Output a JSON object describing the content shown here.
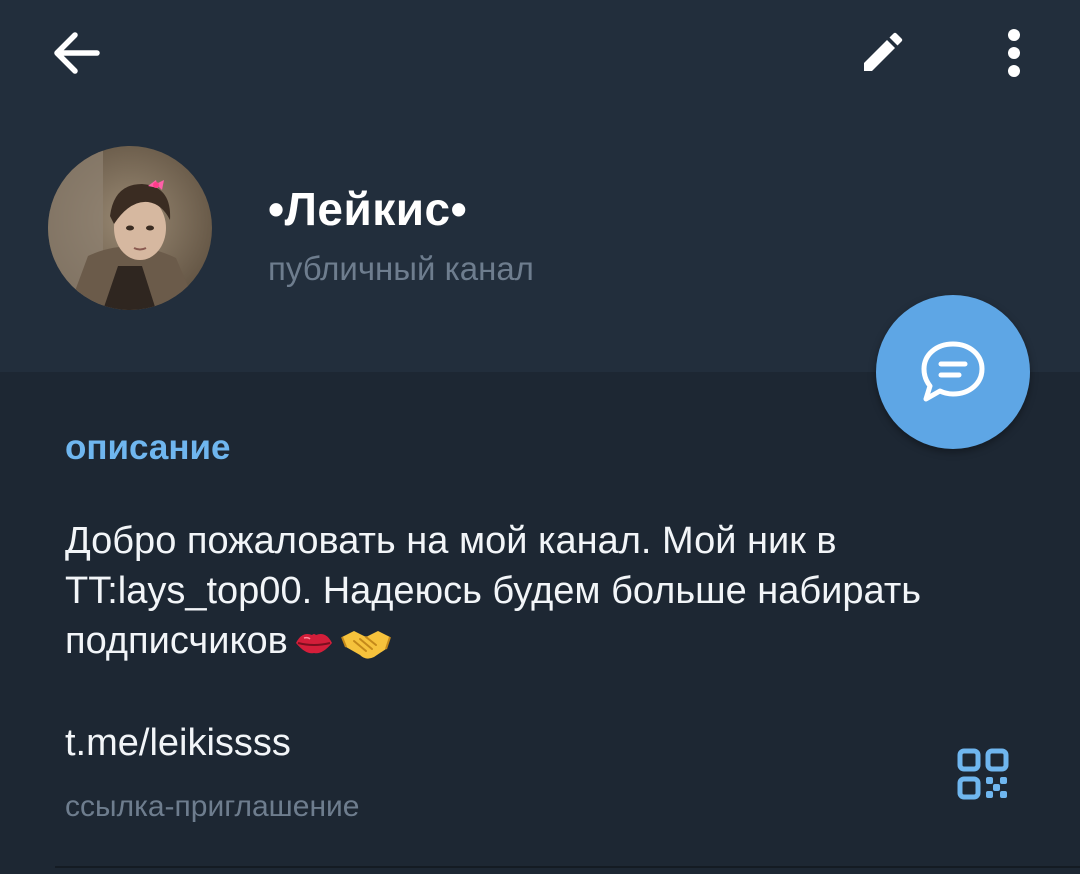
{
  "topbar": {
    "back_icon": "arrow-left-icon",
    "edit_icon": "pencil-icon",
    "more_icon": "more-vertical-icon"
  },
  "channel": {
    "name": "•Лейкис•",
    "type": "публичный канал"
  },
  "fab": {
    "icon": "message-bubble-icon",
    "color": "#5ea6e5"
  },
  "info": {
    "section_title": "описание",
    "description_text": "Добро пожаловать на мой канал. Мой ник в TT:lays_top00. Надеюсь будем больше набирать подписчиков",
    "description_emojis": [
      "kiss-mark-emoji",
      "handshake-emoji"
    ],
    "link": "t.me/leikissss",
    "link_caption": "ссылка-приглашение",
    "qr_icon": "qr-code-icon"
  },
  "colors": {
    "header_bg": "#222e3c",
    "body_bg": "#1d2733",
    "accent": "#6fb6ef",
    "secondary_text": "#6e7d8e",
    "primary_text": "#f2f5f8"
  }
}
